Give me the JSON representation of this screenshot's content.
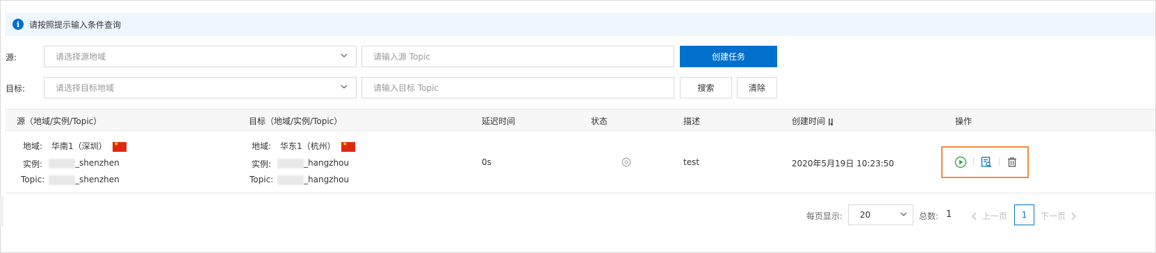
{
  "notice": {
    "text": "请按照提示输入条件查询"
  },
  "filters": {
    "source_label": "源:",
    "target_label": "目标:",
    "source_region_placeholder": "请选择源地域",
    "target_region_placeholder": "请选择目标地域",
    "source_topic_placeholder": "请输入源 Topic",
    "target_topic_placeholder": "请输入目标 Topic",
    "create_button": "创建任务",
    "search_button": "搜索",
    "clear_button": "清除"
  },
  "table": {
    "headers": {
      "source": "源（地域/实例/Topic）",
      "target": "目标（地域/实例/Topic）",
      "delay": "延迟时间",
      "status": "状态",
      "description": "描述",
      "created": "创建时间",
      "actions": "操作"
    },
    "row": {
      "source_region_label": "地域:",
      "source_region_value": "华南1（深圳）",
      "source_instance_label": "实例:",
      "source_instance_value": "_shenzhen",
      "source_topic_label": "Topic:",
      "source_topic_value": "_shenzhen",
      "target_region_label": "地域:",
      "target_region_value": "华东1（杭州）",
      "target_instance_label": "实例:",
      "target_instance_value": "_hangzhou",
      "target_topic_label": "Topic:",
      "target_topic_value": "_hangzhou",
      "delay": "0s",
      "description": "test",
      "created": "2020年5月19日 10:23:50"
    }
  },
  "pagination": {
    "page_size_label": "每页显示:",
    "page_size": "20",
    "total_label": "总数:",
    "total": "1",
    "prev": "上一页",
    "next": "下一页",
    "current": "1"
  },
  "colors": {
    "primary": "#0070cc",
    "highlight": "#f5883a",
    "start": "#2fab47"
  }
}
